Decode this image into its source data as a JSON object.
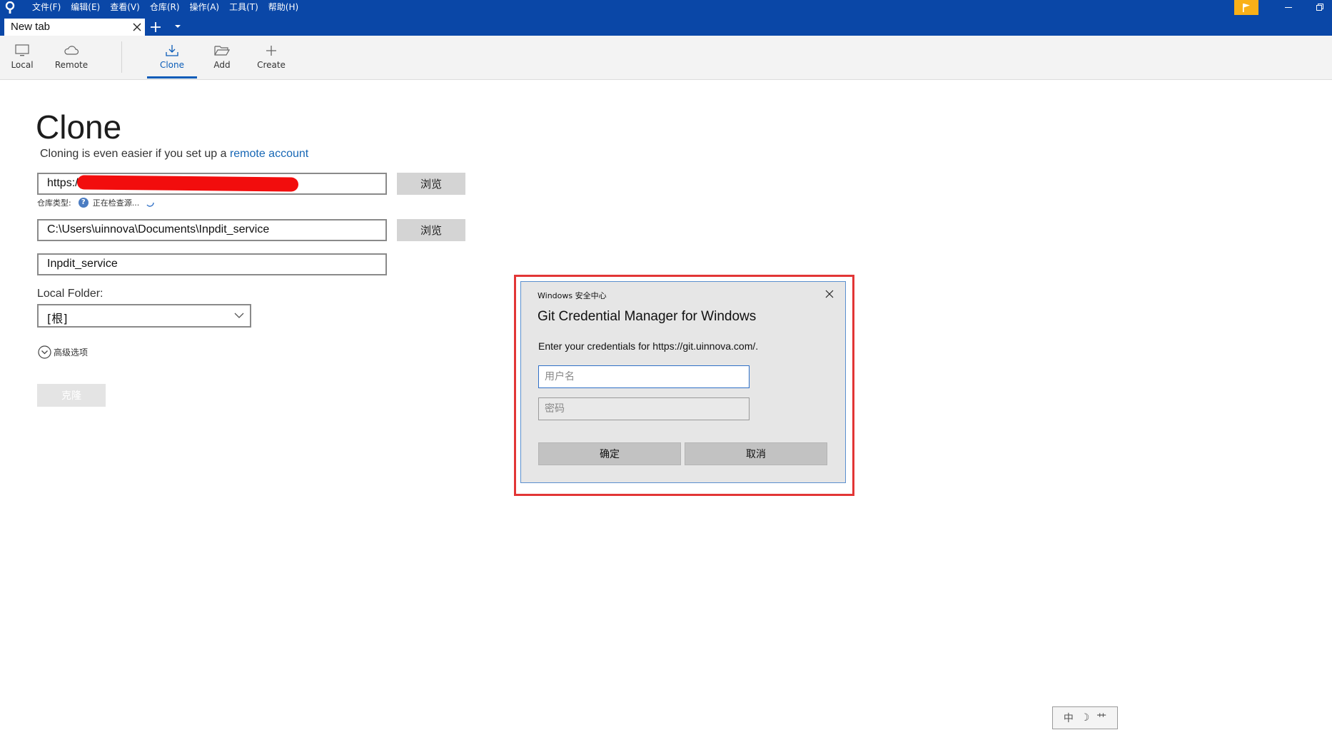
{
  "menu": [
    "文件(F)",
    "编辑(E)",
    "查看(V)",
    "仓库(R)",
    "操作(A)",
    "工具(T)",
    "帮助(H)"
  ],
  "tab": {
    "label": "New tab"
  },
  "toolbar": {
    "local": "Local",
    "remote": "Remote",
    "clone": "Clone",
    "add": "Add",
    "create": "Create"
  },
  "clone": {
    "title": "Clone",
    "subtitle_prefix": "Cloning is even easier if you set up a ",
    "subtitle_link": "remote account",
    "url_value": "https://",
    "browse_label": "浏览",
    "repo_type_label": "仓库类型:",
    "repo_type_status": "正在检查源...",
    "path_value": "C:\\Users\\uinnova\\Documents\\Inpdit_service",
    "name_value": "Inpdit_service",
    "local_folder_label": "Local Folder:",
    "local_folder_value": "[根]",
    "advanced_label": "高级选项",
    "clone_button": "克隆"
  },
  "dialog": {
    "caption": "Windows 安全中心",
    "title": "Git Credential Manager for Windows",
    "prompt": "Enter your credentials for https://git.uinnova.com/.",
    "username_placeholder": "用户名",
    "password_placeholder": "密码",
    "ok_label": "确定",
    "cancel_label": "取消"
  },
  "ime": {
    "mode": "中",
    "moon": "☽",
    "extra": "⺾"
  },
  "colors": {
    "titlebar": "#0a47a7",
    "accent": "#0a5cb8",
    "flag": "#f9b018",
    "highlight": "#e23636",
    "redaction": "#f20d0d"
  }
}
